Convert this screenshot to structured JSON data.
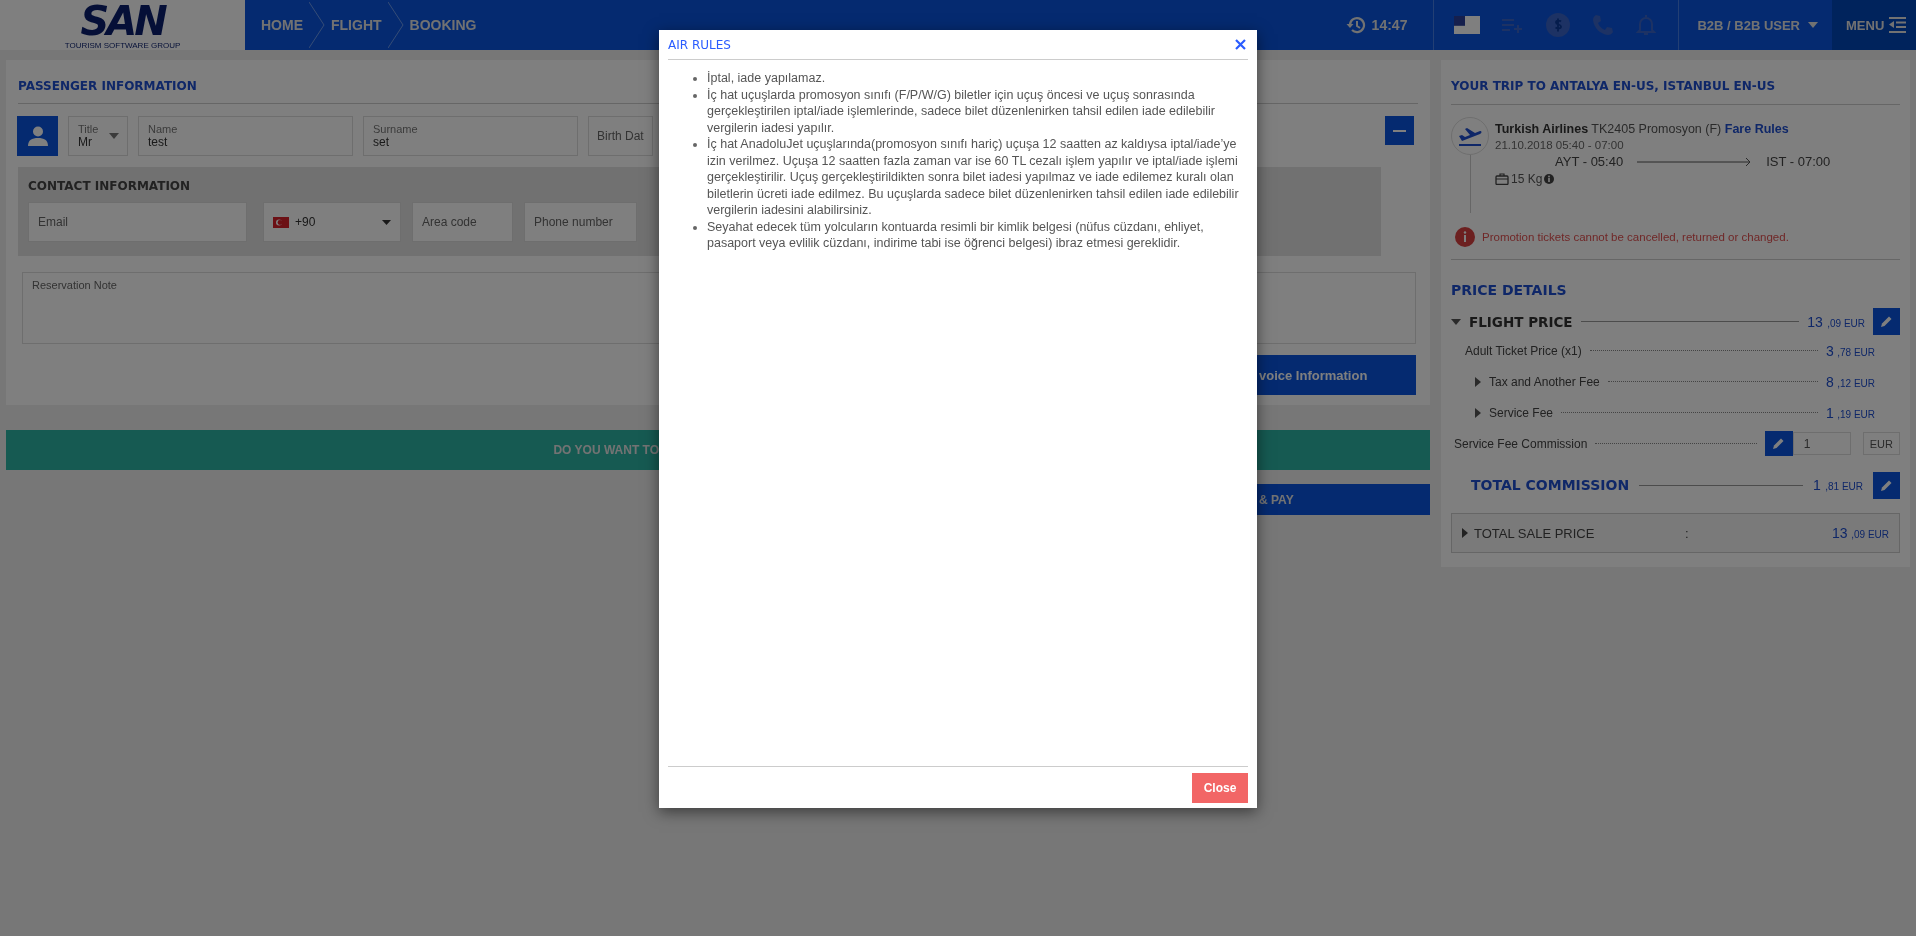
{
  "header": {
    "logo": {
      "name": "SAN",
      "tagline": "TOURISM SOFTWARE GROUP"
    },
    "breadcrumbs": [
      "HOME",
      "FLIGHT",
      "BOOKING"
    ],
    "time": "14:47",
    "user": "B2B / B2B USER",
    "menu": "MENU"
  },
  "passenger": {
    "title": "PASSENGER INFORMATION",
    "fields": [
      {
        "kind": "select",
        "label": "Title",
        "value": "Mr"
      },
      {
        "kind": "text",
        "label": "Name",
        "value": "test"
      },
      {
        "kind": "text",
        "label": "Surname",
        "value": "set"
      },
      {
        "kind": "empty",
        "placeholder": "Birth Dat"
      }
    ]
  },
  "contact": {
    "title": "CONTACT INFORMATION",
    "email": {
      "placeholder": "Email"
    },
    "dial_code": "+90",
    "area_code": {
      "placeholder": "Area code"
    },
    "phone": {
      "placeholder": "Phone number"
    }
  },
  "reservation_note": {
    "placeholder": "Reservation Note"
  },
  "invoice_button": "voice Information",
  "extras_bar": "DO YOU WANT TO",
  "pay_button": "& PAY",
  "trip": {
    "title": "YOUR TRIP TO ANTALYA EN-US, ISTANBUL EN-US",
    "airline": "Turkish Airlines",
    "flight_info": "TK2405 Promosyon (F)",
    "fare_rules": "Fare Rules",
    "date": "21.10.2018 05:40 - 07:00",
    "from": "AYT - 05:40",
    "to": "IST - 07:00",
    "baggage": "15 Kg",
    "warning": "Promotion tickets cannot be cancelled, returned or changed."
  },
  "price": {
    "title": "PRICE DETAILS",
    "flight_price": {
      "label": "FLIGHT PRICE",
      "expanded": true,
      "int": "13",
      "dec": ",09 EUR"
    },
    "lines": [
      {
        "kind": "plain",
        "label": "Adult Ticket Price (x1)",
        "int": "3",
        "dec": ",78 EUR"
      },
      {
        "kind": "expandable",
        "expanded": false,
        "label": "Tax and Another Fee",
        "int": "8",
        "dec": ",12 EUR"
      },
      {
        "kind": "expandable",
        "expanded": false,
        "label": "Service Fee",
        "int": "1",
        "dec": ",19 EUR"
      }
    ],
    "commission": {
      "label": "Service Fee Commission",
      "value": "1",
      "currency": "EUR"
    },
    "total_commission": {
      "label": "TOTAL COMMISSION",
      "int": "1",
      "dec": ",81 EUR"
    },
    "total_sale": {
      "label": "TOTAL SALE PRICE",
      "expanded": false,
      "separator": ":",
      "int": "13",
      "dec": ",09 EUR"
    }
  },
  "modal": {
    "title": "AIR RULES",
    "rules": [
      "İptal, iade yapılamaz.",
      "İç hat uçuşlarda promosyon sınıfı (F/P/W/G) biletler için uçuş öncesi ve uçuş sonrasında gerçekleştirilen iptal/iade işlemlerinde, sadece bilet düzenlenirken tahsil edilen iade edilebilir vergilerin iadesi yapılır.",
      "İç hat AnadoluJet uçuşlarında(promosyon sınıfı hariç) uçuşa 12 saatten az kaldıysa iptal/iade’ye izin verilmez. Uçuşa 12 saatten fazla zaman var ise 60 TL cezalı işlem yapılır ve iptal/iade işlemi gerçekleştirilir. Uçuş gerçekleştirildikten sonra bilet iadesi yapılmaz ve iade edilemez kuralı olan biletlerin ücreti iade edilmez. Bu uçuşlarda sadece bilet düzenlenirken tahsil edilen iade edilebilir vergilerin iadesini alabilirsiniz.",
      "Seyahat edecek tüm yolcuların kontuarda resimli bir kimlik belgesi (nüfus cüzdanı, ehliyet, pasaport veya evlilik cüzdanı, indirime tabi ise öğrenci belgesi) ibraz etmesi gereklidir."
    ],
    "close": "Close"
  }
}
